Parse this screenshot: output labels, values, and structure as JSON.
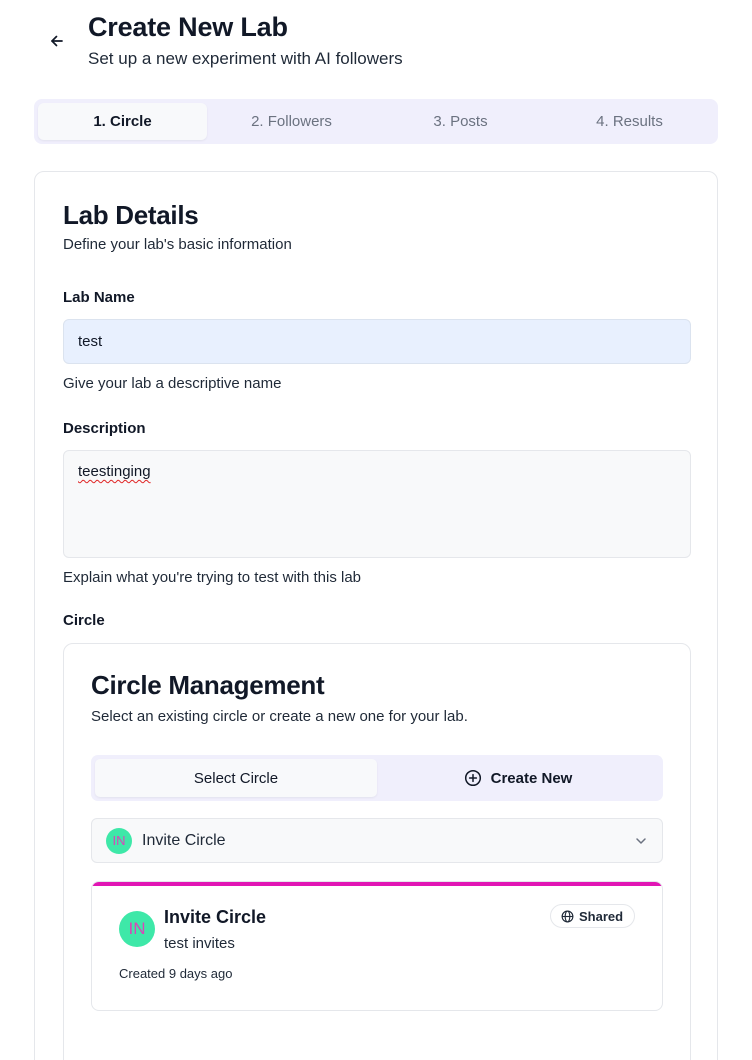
{
  "header": {
    "title": "Create New Lab",
    "subtitle": "Set up a new experiment with AI followers"
  },
  "steps": [
    {
      "label": "1. Circle",
      "active": true
    },
    {
      "label": "2. Followers",
      "active": false
    },
    {
      "label": "3. Posts",
      "active": false
    },
    {
      "label": "4. Results",
      "active": false
    }
  ],
  "lab_details": {
    "title": "Lab Details",
    "description": "Define your lab's basic information",
    "name_label": "Lab Name",
    "name_value": "test",
    "name_helper": "Give your lab a descriptive name",
    "description_label": "Description",
    "description_value": "teestinging",
    "description_helper": "Explain what you're trying to test with this lab",
    "circle_label": "Circle"
  },
  "circle_management": {
    "title": "Circle Management",
    "description": "Select an existing circle or create a new one for your lab.",
    "tabs": {
      "select": "Select Circle",
      "create": "Create New"
    },
    "selected": {
      "initials": "IN",
      "name": "Invite Circle"
    },
    "card": {
      "initials": "IN",
      "name": "Invite Circle",
      "subtitle": "test invites",
      "created": "Created 9 days ago",
      "badge": "Shared"
    }
  },
  "colors": {
    "accent": "#e116b4",
    "avatar_bg": "#3ee8a8",
    "avatar_text": "#d946b8",
    "tab_bg": "#f0effc",
    "input_filled_bg": "#e8f0fe"
  },
  "icons": {
    "back": "arrow-left-icon",
    "create": "plus-circle-icon",
    "dropdown": "chevron-down-icon",
    "shared": "globe-icon"
  }
}
